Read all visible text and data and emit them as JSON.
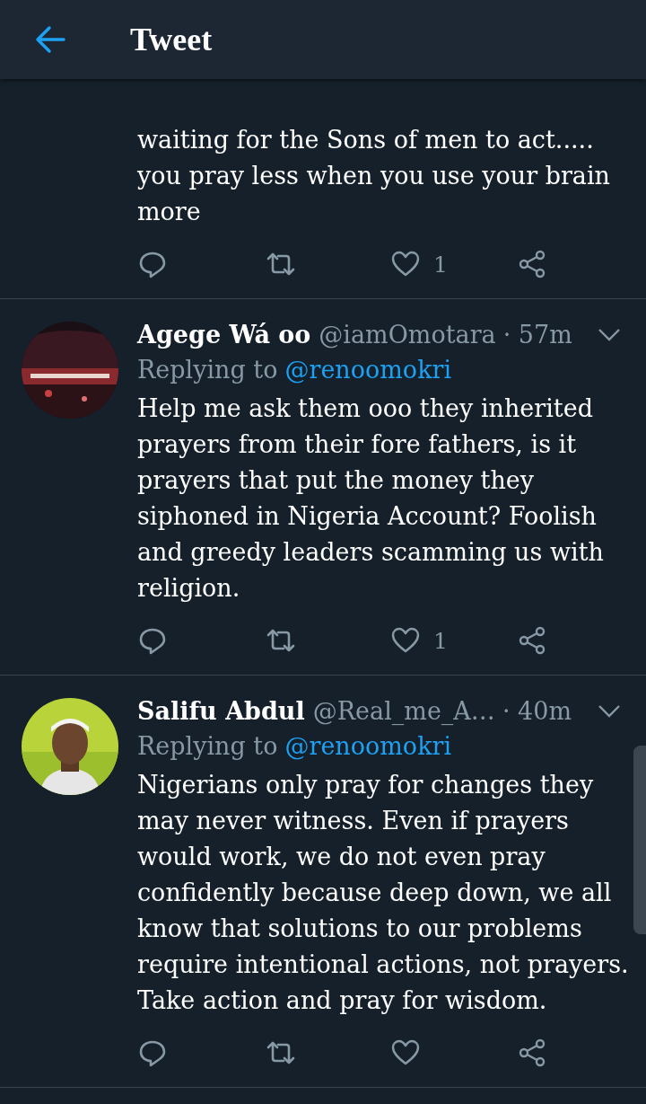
{
  "header": {
    "title": "Tweet"
  },
  "tweets": [
    {
      "text": "waiting for the Sons of men to act..... you pray less when you use your brain more",
      "like_count": "1"
    },
    {
      "name": "Agege Wá oo",
      "handle": "@iamOmotara",
      "time": "· 57m",
      "replying_label": "Replying to",
      "replying_to": "@renoomokri",
      "text": "Help me ask them ooo they inherited prayers from their fore fathers, is it prayers that put the money they siphoned in Nigeria Account? Foolish and greedy leaders scamming us with religion.",
      "like_count": "1"
    },
    {
      "name": "Salifu Abdul",
      "handle": "@Real_me_A…",
      "time": "· 40m",
      "replying_label": "Replying to",
      "replying_to": "@renoomokri",
      "text": "Nigerians only pray for changes they may never witness. Even if prayers would work, we do not even pray confidently because deep down, we all know that solutions to our problems require intentional actions, not prayers. Take action and pray for wisdom."
    }
  ]
}
